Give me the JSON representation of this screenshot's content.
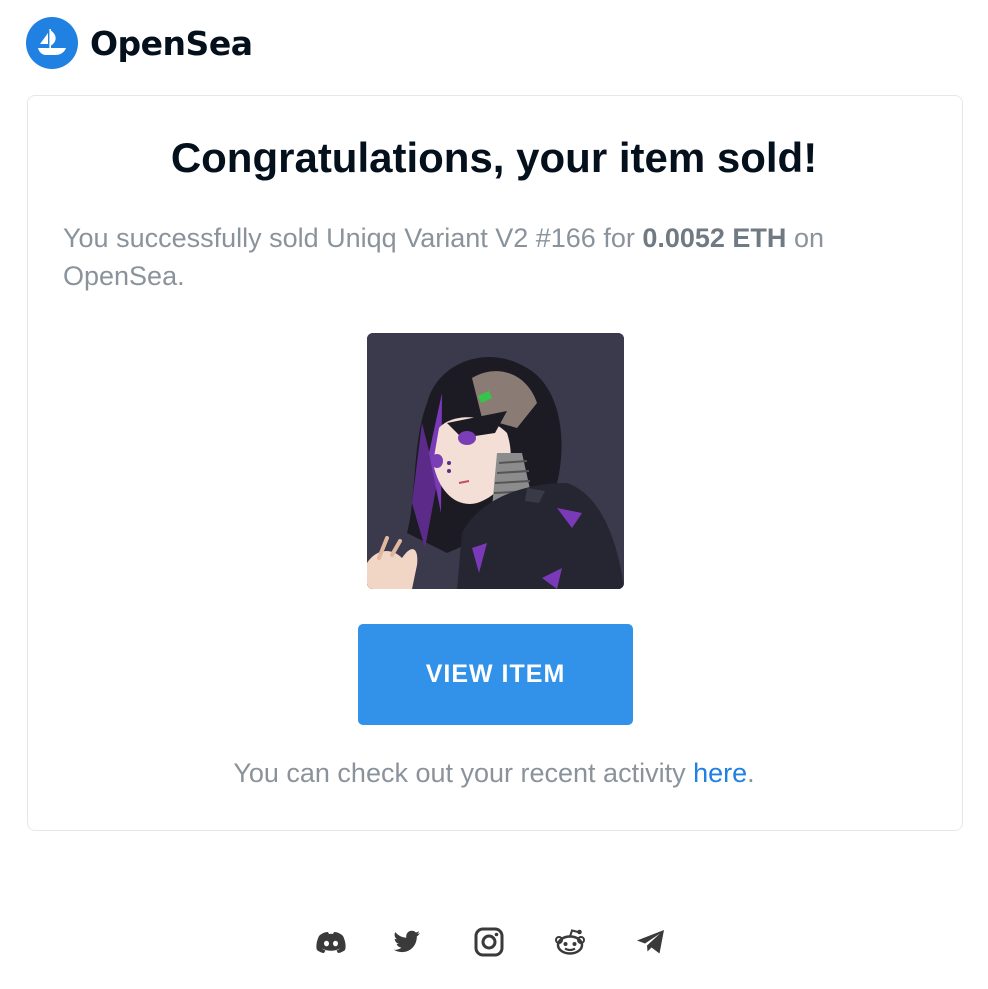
{
  "header": {
    "brand": "OpenSea",
    "logo_icon": "opensea-boat-icon"
  },
  "email": {
    "title": "Congratulations, your item sold!",
    "message_prefix": "You successfully sold Uniqq Variant V2 #166 for ",
    "price": "0.0052 ETH",
    "message_suffix": " on OpenSea.",
    "item_image": "anime-character-nft-image",
    "button_label": "VIEW ITEM",
    "activity_prefix": "You can check out your recent activity ",
    "activity_link": "here",
    "activity_suffix": "."
  },
  "footer": {
    "social_icons": [
      "discord-icon",
      "twitter-icon",
      "instagram-icon",
      "reddit-icon",
      "telegram-icon"
    ]
  },
  "colors": {
    "brand_blue": "#2081e2",
    "button_blue": "#3291e9",
    "title_text": "#04111d",
    "body_text": "#8a939b"
  }
}
